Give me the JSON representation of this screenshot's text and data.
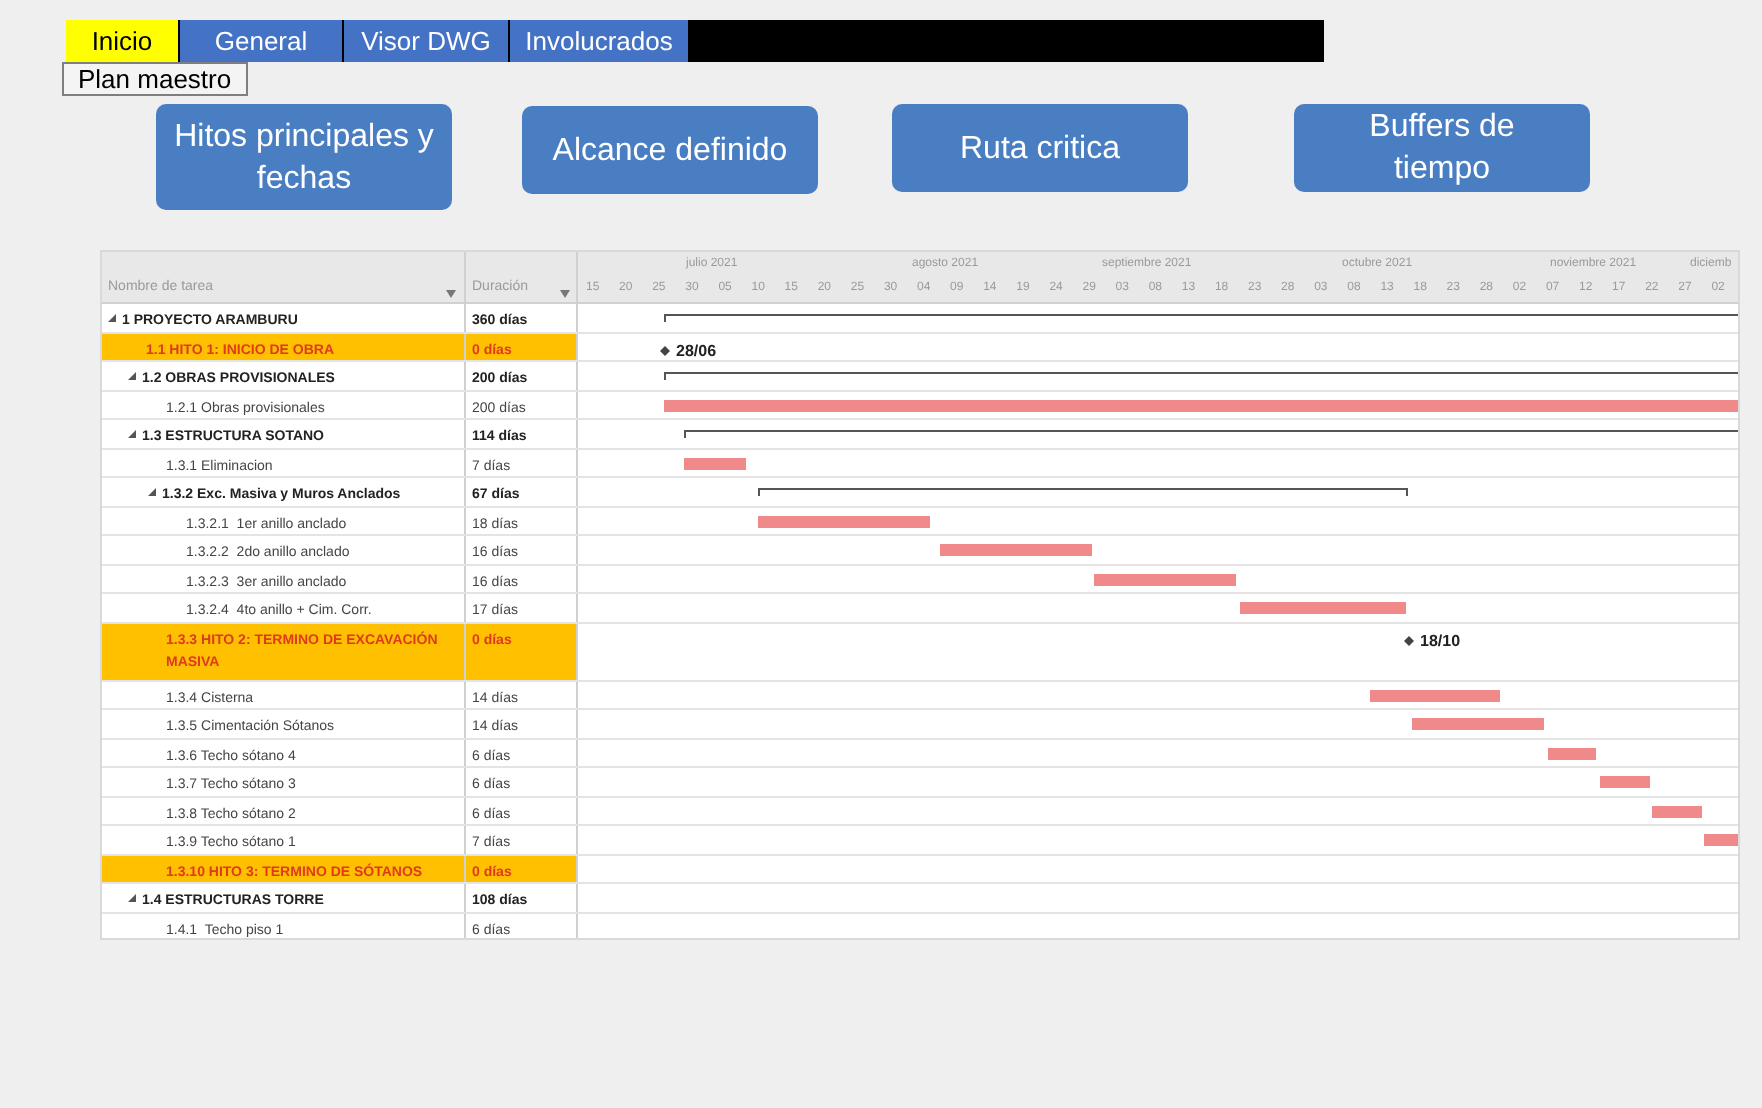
{
  "tabs": [
    {
      "label": "Inicio",
      "selected": true
    },
    {
      "label": "General",
      "selected": false
    },
    {
      "label": "Visor DWG",
      "selected": false
    },
    {
      "label": "Involucrados",
      "selected": false
    }
  ],
  "subnav": {
    "label": "Plan maestro"
  },
  "action_buttons": [
    "Hitos principales y fechas",
    "Alcance definido",
    "Ruta critica",
    "Buffers de tiempo"
  ],
  "table": {
    "columns": [
      "Nombre de tarea",
      "Duración"
    ],
    "timescale": {
      "months": [
        "julio 2021",
        "agosto 2021",
        "septiembre 2021",
        "octubre 2021",
        "noviembre 2021",
        "diciemb"
      ],
      "days": [
        "15",
        "20",
        "25",
        "30",
        "05",
        "10",
        "15",
        "20",
        "25",
        "30",
        "04",
        "09",
        "14",
        "19",
        "24",
        "29",
        "03",
        "08",
        "13",
        "18",
        "23",
        "28",
        "03",
        "08",
        "13",
        "18",
        "23",
        "28",
        "02",
        "07",
        "12",
        "17",
        "22",
        "27",
        "02"
      ]
    },
    "rows": [
      {
        "kind": "summary",
        "expanded": true,
        "name": "1 PROYECTO ARAMBURU",
        "duration": "360 días",
        "children": [
          {
            "kind": "milestone",
            "name": "1.1 HITO 1: INICIO DE OBRA",
            "duration": "0 días",
            "date_label": "28/06"
          },
          {
            "kind": "summary",
            "expanded": true,
            "name": "1.2 OBRAS PROVISIONALES",
            "duration": "200 días",
            "children": [
              {
                "kind": "task",
                "name": "1.2.1 Obras provisionales",
                "duration": "200 días"
              }
            ]
          },
          {
            "kind": "summary",
            "expanded": true,
            "name": "1.3 ESTRUCTURA SOTANO",
            "duration": "114 días",
            "children": [
              {
                "kind": "task",
                "name": "1.3.1 Eliminacion",
                "duration": "7 días"
              },
              {
                "kind": "summary",
                "expanded": true,
                "name": "1.3.2 Exc. Masiva y Muros Anclados",
                "duration": "67 días",
                "children": [
                  {
                    "kind": "task",
                    "name": "1.3.2.1  1er anillo anclado",
                    "duration": "18 días"
                  },
                  {
                    "kind": "task",
                    "name": "1.3.2.2  2do anillo anclado",
                    "duration": "16 días"
                  },
                  {
                    "kind": "task",
                    "name": "1.3.2.3  3er anillo anclado",
                    "duration": "16 días"
                  },
                  {
                    "kind": "task",
                    "name": "1.3.2.4  4to anillo + Cim. Corr.",
                    "duration": "17 días"
                  }
                ]
              },
              {
                "kind": "milestone",
                "name": "1.3.3 HITO 2: TERMINO DE EXCAVACIÓN MASIVA",
                "duration": "0 días",
                "date_label": "18/10"
              },
              {
                "kind": "task",
                "name": "1.3.4 Cisterna",
                "duration": "14 días"
              },
              {
                "kind": "task",
                "name": "1.3.5 Cimentación Sótanos",
                "duration": "14 días"
              },
              {
                "kind": "task",
                "name": "1.3.6 Techo sótano 4",
                "duration": "6 días"
              },
              {
                "kind": "task",
                "name": "1.3.7 Techo sótano 3",
                "duration": "6 días"
              },
              {
                "kind": "task",
                "name": "1.3.8 Techo sótano 2",
                "duration": "6 días"
              },
              {
                "kind": "task",
                "name": "1.3.9 Techo sótano 1",
                "duration": "7 días"
              },
              {
                "kind": "milestone",
                "name": "1.3.10 HITO 3: TERMINO DE SÓTANOS",
                "duration": "0 días"
              }
            ]
          },
          {
            "kind": "summary",
            "expanded": true,
            "name": "1.4 ESTRUCTURAS TORRE",
            "duration": "108 días",
            "children": [
              {
                "kind": "task",
                "name": "1.4.1  Techo piso 1",
                "duration": "6 días"
              }
            ]
          }
        ]
      }
    ]
  }
}
